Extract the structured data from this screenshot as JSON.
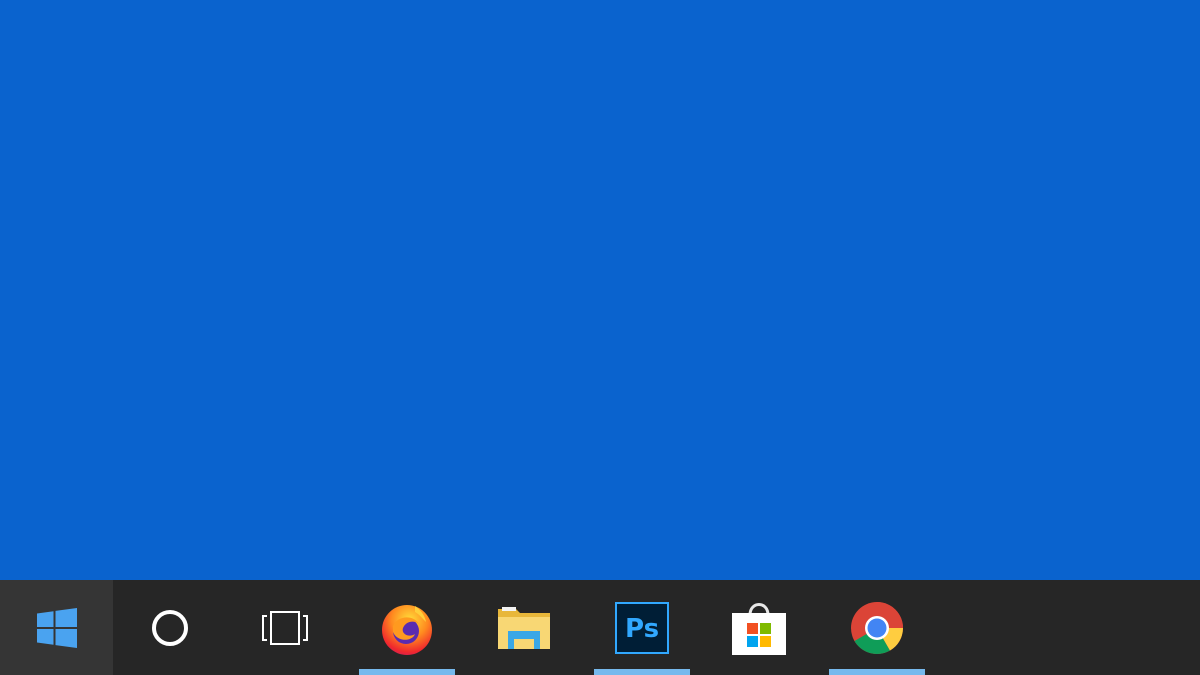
{
  "taskbar": {
    "background": "#262626",
    "running_indicator_color": "#76b9ed",
    "buttons": [
      {
        "name": "start",
        "icon": "windows-logo-icon",
        "running": false
      },
      {
        "name": "cortana",
        "icon": "cortana-ring-icon",
        "running": false
      },
      {
        "name": "task-view",
        "icon": "task-view-icon",
        "running": false
      },
      {
        "name": "firefox",
        "icon": "firefox-icon",
        "running": true
      },
      {
        "name": "file-explorer",
        "icon": "folder-icon",
        "running": false
      },
      {
        "name": "photoshop",
        "icon": "photoshop-icon",
        "running": true,
        "label": "Ps"
      },
      {
        "name": "microsoft-store",
        "icon": "store-bag-icon",
        "running": false
      },
      {
        "name": "chrome",
        "icon": "chrome-icon",
        "running": true
      }
    ]
  },
  "desktop": {
    "background": "#0a63ce"
  }
}
